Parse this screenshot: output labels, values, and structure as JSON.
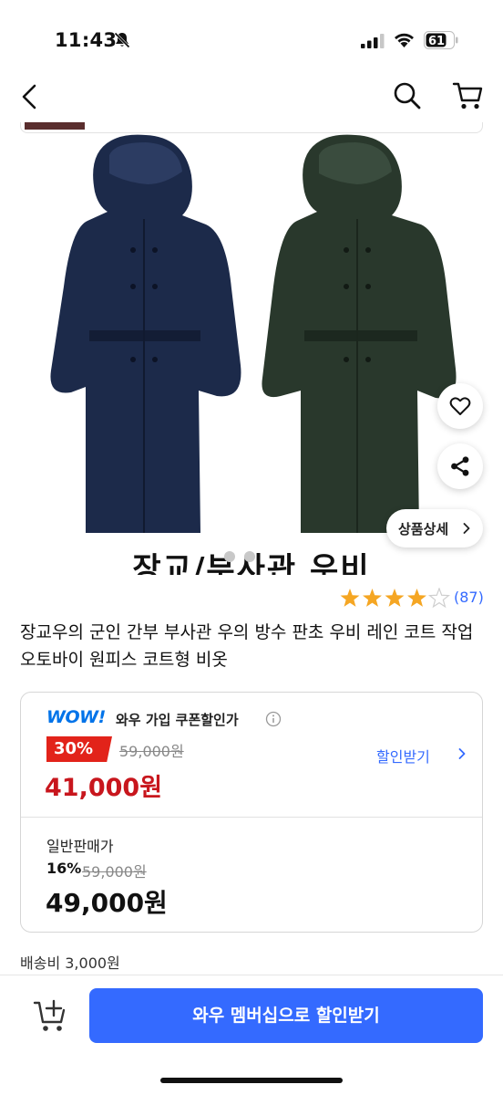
{
  "status_bar": {
    "time": "11:43",
    "battery_level": "61",
    "icons": [
      "bell-off-icon",
      "signal-icon",
      "wifi-icon",
      "battery-icon"
    ]
  },
  "nav": {
    "icons": [
      "back-icon",
      "search-icon",
      "cart-icon"
    ]
  },
  "gallery": {
    "caption": "장교/부사관 우비",
    "detail_button": "상품상세",
    "icons": [
      "heart-icon",
      "share-icon"
    ]
  },
  "rating": {
    "stars": 4,
    "review_count": "(87)"
  },
  "product": {
    "title": "장교우의 군인 간부 부사관 우의 방수 판초 우비 레인 코트 작업 오토바이 원피스 코트형 비옷"
  },
  "wow_price": {
    "logo": "WOW!",
    "label": "와우 가입 쿠폰할인가",
    "discount_rate": "30%",
    "original_price": "59,000원",
    "final_price": "41,000원",
    "coupon_link": "할인받기"
  },
  "normal_price": {
    "label": "일반판매가",
    "discount_rate": "16%",
    "original_price": "59,000원",
    "final_price": "49,000원"
  },
  "shipping": {
    "text": "배송비 3,000원"
  },
  "bottom_bar": {
    "cta": "와우 멤버십으로 할인받기"
  },
  "colors": {
    "accent_blue": "#346aff",
    "sale_red": "#e2231a",
    "price_red": "#c8161d",
    "wow_blue": "#0073e9",
    "star_orange": "#f5a623"
  }
}
